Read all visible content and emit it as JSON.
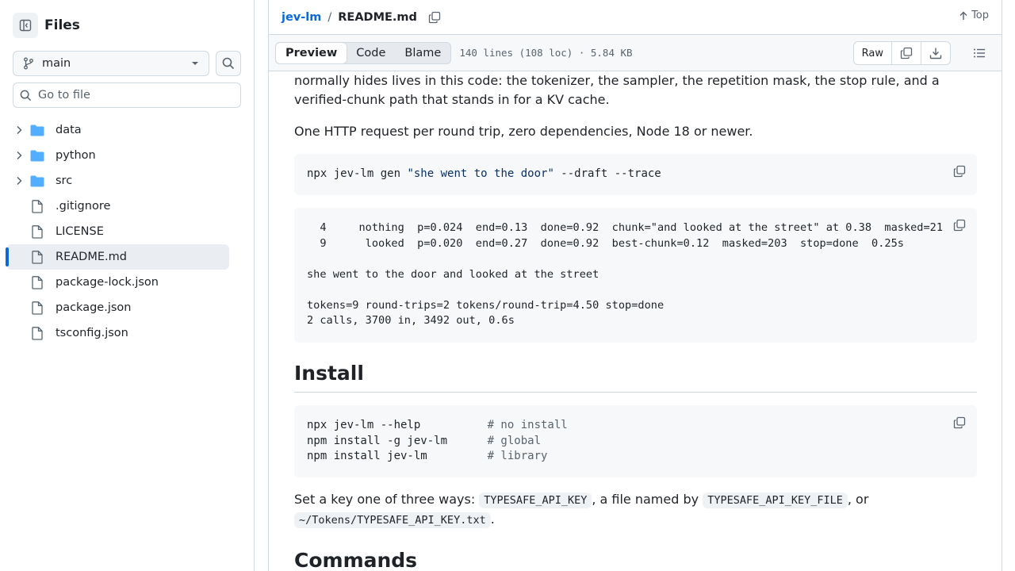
{
  "sidebar": {
    "title": "Files",
    "branch": "main",
    "goto_placeholder": "Go to file",
    "items": [
      {
        "name": "data",
        "type": "folder"
      },
      {
        "name": "python",
        "type": "folder"
      },
      {
        "name": "src",
        "type": "folder"
      },
      {
        "name": ".gitignore",
        "type": "file"
      },
      {
        "name": "LICENSE",
        "type": "file"
      },
      {
        "name": "README.md",
        "type": "file",
        "selected": true
      },
      {
        "name": "package-lock.json",
        "type": "file"
      },
      {
        "name": "package.json",
        "type": "file"
      },
      {
        "name": "tsconfig.json",
        "type": "file"
      }
    ]
  },
  "header": {
    "repo": "jev-lm",
    "separator": "/",
    "file": "README.md",
    "top_label": "Top"
  },
  "toolbar": {
    "tabs": [
      "Preview",
      "Code",
      "Blame"
    ],
    "active_tab": "Preview",
    "meta": "140 lines (108 loc) · 5.84 KB",
    "raw_label": "Raw"
  },
  "readme": {
    "intro_line1": "normally hides lives in this code: the tokenizer, the sampler, the repetition mask, the stop rule, and a",
    "intro_line2": "verified-chunk path that stands in for a KV cache.",
    "requirements": "One HTTP request per round trip, zero dependencies, Node 18 or newer.",
    "code1": {
      "cmd": "npx jev-lm gen ",
      "arg": "\"she went to the door\"",
      "flags": " --draft --trace"
    },
    "trace": {
      "line1": "  4     nothing  p=0.024  end=0.13  done=0.92  chunk=\"and looked at the street\" at 0.38  masked=21",
      "line2": "  9      looked  p=0.020  end=0.27  done=0.92  best-chunk=0.12  masked=203  stop=done  0.25s",
      "line3": "",
      "line4": "she went to the door and looked at the street",
      "line5": "",
      "line6": "tokens=9 round-trips=2 tokens/round-trip=4.50 stop=done",
      "line7": "2 calls, 3700 in, 3492 out, 0.6s"
    },
    "install_heading": "Install",
    "install": [
      {
        "cmd": "npx jev-lm --help          ",
        "comment": "# no install"
      },
      {
        "cmd": "npm install -g jev-lm      ",
        "comment": "# global"
      },
      {
        "cmd": "npm install jev-lm         ",
        "comment": "# library"
      }
    ],
    "key_text1": "Set a key one of three ways: ",
    "key_code1": "TYPESAFE_API_KEY",
    "key_text2": ", a file named by ",
    "key_code2": "TYPESAFE_API_KEY_FILE",
    "key_text3": ", or",
    "key_code3": "~/Tokens/TYPESAFE_API_KEY.txt",
    "key_text4": ".",
    "commands_heading": "Commands"
  },
  "colors": {
    "accent": "#0969da",
    "folder": "#54aeff"
  }
}
